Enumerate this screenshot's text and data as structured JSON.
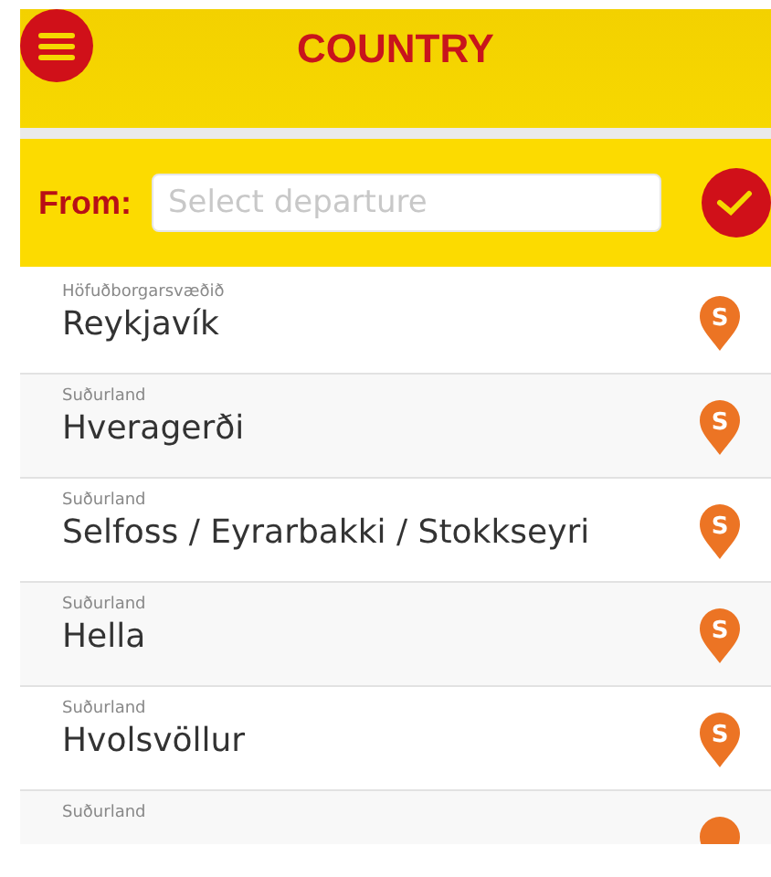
{
  "header": {
    "title": "COUNTRY"
  },
  "search": {
    "label": "From:",
    "placeholder": "Select departure"
  },
  "stops": [
    {
      "region": "Höfuðborgarsvæðið",
      "name": "Reykjavík",
      "pin": "S"
    },
    {
      "region": "Suðurland",
      "name": "Hveragerði",
      "pin": "S"
    },
    {
      "region": "Suðurland",
      "name": "Selfoss / Eyrarbakki / Stokkseyri",
      "pin": "S"
    },
    {
      "region": "Suðurland",
      "name": "Hella",
      "pin": "S"
    },
    {
      "region": "Suðurland",
      "name": "Hvolsvöllur",
      "pin": "S"
    },
    {
      "region": "Suðurland"
    }
  ]
}
